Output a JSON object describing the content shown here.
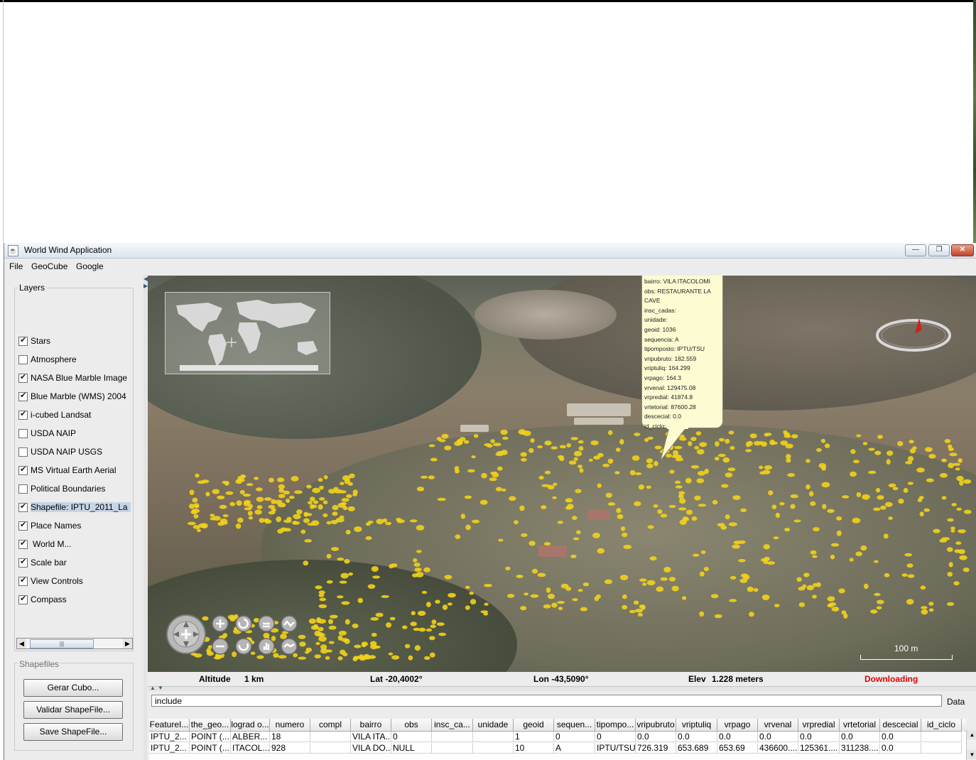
{
  "window": {
    "title": "World Wind Application"
  },
  "menu": {
    "file": "File",
    "geocube": "GeoCube",
    "google": "Google"
  },
  "layers": {
    "title": "Layers",
    "items": [
      {
        "label": "Stars",
        "checked": true
      },
      {
        "label": "Atmosphere",
        "checked": false
      },
      {
        "label": "NASA Blue Marble Image",
        "checked": true
      },
      {
        "label": "Blue Marble (WMS) 2004",
        "checked": true
      },
      {
        "label": "i-cubed Landsat",
        "checked": true
      },
      {
        "label": "USDA NAIP",
        "checked": false
      },
      {
        "label": "USDA NAIP USGS",
        "checked": false
      },
      {
        "label": "MS Virtual Earth Aerial",
        "checked": true
      },
      {
        "label": "Political Boundaries",
        "checked": false
      },
      {
        "label": "Shapefile: IPTU_2011_La",
        "checked": true
      },
      {
        "label": "Place Names",
        "checked": true
      },
      {
        "label": "World M...",
        "checked": true
      },
      {
        "label": "Scale bar",
        "checked": true
      },
      {
        "label": "View Controls",
        "checked": true
      },
      {
        "label": "Compass",
        "checked": true
      }
    ]
  },
  "shapefiles": {
    "title": "Shapefiles",
    "buttons": [
      "Gerar Cubo...",
      "Validar ShapeFile...",
      "Save ShapeFile..."
    ]
  },
  "tooltip": {
    "lines": [
      "bairro: VILA ITACOLOMI",
      "obs: RESTAURANTE LA",
      "CAVE",
      "insc_cadas:",
      "unidade:",
      "geoid: 1036",
      "sequencia: A",
      "tipomposto: IPTU/TSU",
      "vripubruto: 182.559",
      "vriptuliq: 164.299",
      "vrpago: 164.3",
      "vrvenal: 129475.08",
      "vrpredial: 41874.8",
      "vrtetorial: 87600.28",
      "descecial: 0.0",
      "id_ciclo:"
    ]
  },
  "scalebar": {
    "label": "100 m"
  },
  "status": {
    "altitude_label": "Altitude",
    "altitude_value": "1 km",
    "lat": "Lat -20,4002°",
    "lon": "Lon -43,5090°",
    "elev_label": "Elev",
    "elev_value": "1.228 meters",
    "downloading": "Downloading"
  },
  "filter": {
    "value": "include",
    "data_button": "Data"
  },
  "table": {
    "columns": [
      "FeatureI...",
      "the_geo...",
      "lograd o...",
      "numero",
      "compl",
      "bairro",
      "obs",
      "insc_ca...",
      "unidade",
      "geoid",
      "sequen...",
      "tipompo...",
      "vripubruto",
      "vriptuliq",
      "vrpago",
      "vrvenal",
      "vrpredial",
      "vrtetorial",
      "descecial",
      "id_ciclo"
    ],
    "rows": [
      [
        "IPTU_2...",
        "POINT (...",
        "ALBER...",
        "18",
        "",
        "VILA ITA...",
        "0",
        "",
        "",
        "1",
        "0",
        "0",
        "0.0",
        "0.0",
        "0.0",
        "0.0",
        "0.0",
        "0.0",
        "0.0",
        ""
      ],
      [
        "IPTU_2...",
        "POINT (...",
        "ITACOL...",
        "928",
        "",
        "VILA DO...",
        "NULL",
        "",
        "",
        "10",
        "A",
        "IPTU/TSU",
        "726.319",
        "653.689",
        "653.69",
        "436600....",
        "125361....",
        "311238....",
        "0.0",
        ""
      ]
    ]
  },
  "colors": {
    "downloading": "#e00000",
    "accent": "#c6d5e6",
    "point_marker": "#f2d21a"
  }
}
